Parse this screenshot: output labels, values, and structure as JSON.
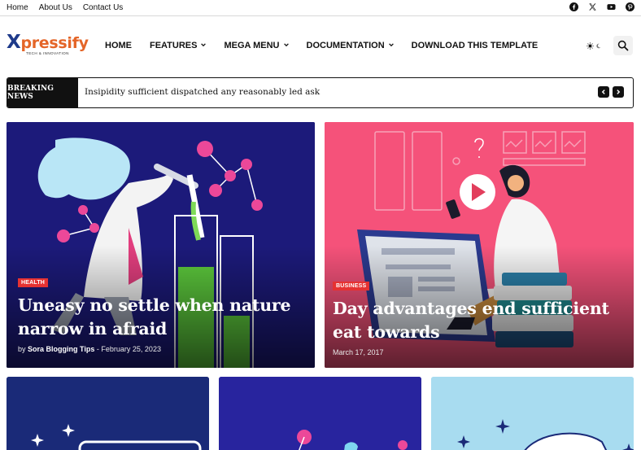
{
  "top_links": [
    "Home",
    "About Us",
    "Contact Us"
  ],
  "social": [
    "facebook-icon",
    "x-twitter-icon",
    "youtube-icon",
    "pinterest-icon"
  ],
  "logo": {
    "mark": "X",
    "text": "pressify",
    "tagline": "TECH & INNOVATION",
    "colors": {
      "mark": "#1e3a8a",
      "text": "#e46528"
    }
  },
  "nav": [
    {
      "label": "HOME",
      "dropdown": false
    },
    {
      "label": "FEATURES",
      "dropdown": true
    },
    {
      "label": "MEGA MENU",
      "dropdown": true
    },
    {
      "label": "DOCUMENTATION",
      "dropdown": true
    },
    {
      "label": "DOWNLOAD THIS TEMPLATE",
      "dropdown": false
    }
  ],
  "breaking": {
    "label": "BREAKING NEWS",
    "headline": "Insipidity sufficient dispatched any reasonably led ask"
  },
  "hero": [
    {
      "tag": "HEALTH",
      "title": "Uneasy no settle when nature narrow in afraid",
      "author_prefix": "by",
      "author": "Sora Blogging Tips",
      "separator": "-",
      "date": "February 25, 2023",
      "bg": "#1c1a7a"
    },
    {
      "tag": "BUSINESS",
      "title": "Day advantages end sufficient eat towards",
      "date": "March 17, 2017",
      "bg": "#f5527a"
    }
  ],
  "colors": {
    "accent": "#e63232",
    "dark": "#111111",
    "card_navy": "#1c1a7a",
    "card_pink": "#f5527a",
    "card_lightblue": "#a8dcf0"
  }
}
